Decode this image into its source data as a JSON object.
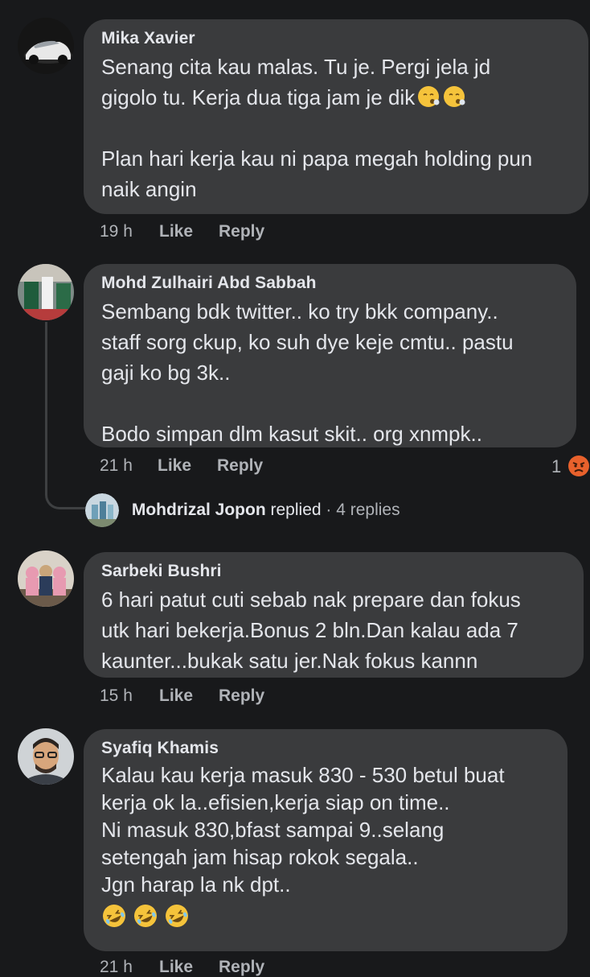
{
  "comments": [
    {
      "author": "Mika Xavier",
      "lines": [
        "Senang cita kau malas. Tu je. Pergi jela jd",
        "gigolo tu. Kerja dua tiga jam je dik"
      ],
      "lines2": [
        "Plan hari kerja kau ni papa megah holding pun",
        "naik angin"
      ],
      "emoji": "face-exhaling-emoji",
      "time": "19 h",
      "like": "Like",
      "reply": "Reply"
    },
    {
      "author": "Mohd Zulhairi Abd Sabbah",
      "lines": [
        "Sembang bdk twitter.. ko try bkk company..",
        "staff sorg ckup, ko suh dye keje cmtu.. pastu",
        "gaji ko bg 3k.."
      ],
      "lines2": [
        "Bodo simpan dlm kasut skit.. org xnmpk.."
      ],
      "time": "21 h",
      "like": "Like",
      "reply": "Reply",
      "reaction_count": "1",
      "reaction_emoji": "angry-face-emoji",
      "replies": {
        "author": "Mohdrizal Jopon",
        "verb": " replied",
        "sep": " · ",
        "count": "4 replies"
      }
    },
    {
      "author": "Sarbeki Bushri",
      "lines": [
        "6 hari patut cuti sebab nak prepare dan fokus",
        "utk hari bekerja.Bonus 2 bln.Dan kalau ada 7",
        "kaunter...bukak satu jer.Nak fokus kannn"
      ],
      "time": "15 h",
      "like": "Like",
      "reply": "Reply"
    },
    {
      "author": "Syafiq Khamis",
      "lines": [
        "Kalau kau kerja masuk 830 - 530 betul buat",
        "kerja ok la..efisien,kerja siap on time..",
        "Ni masuk 830,bfast sampai 9..selang",
        "setengah jam hisap rokok segala..",
        "Jgn harap la nk dpt.."
      ],
      "emojis": "laughing-rolling-emoji x3",
      "time": "21 h",
      "like": "Like",
      "reply": "Reply"
    }
  ],
  "colors": {
    "background": "#18191b",
    "bubble": "#3a3b3d",
    "text": "#e4e6eb",
    "muted": "#b0b3b8"
  }
}
